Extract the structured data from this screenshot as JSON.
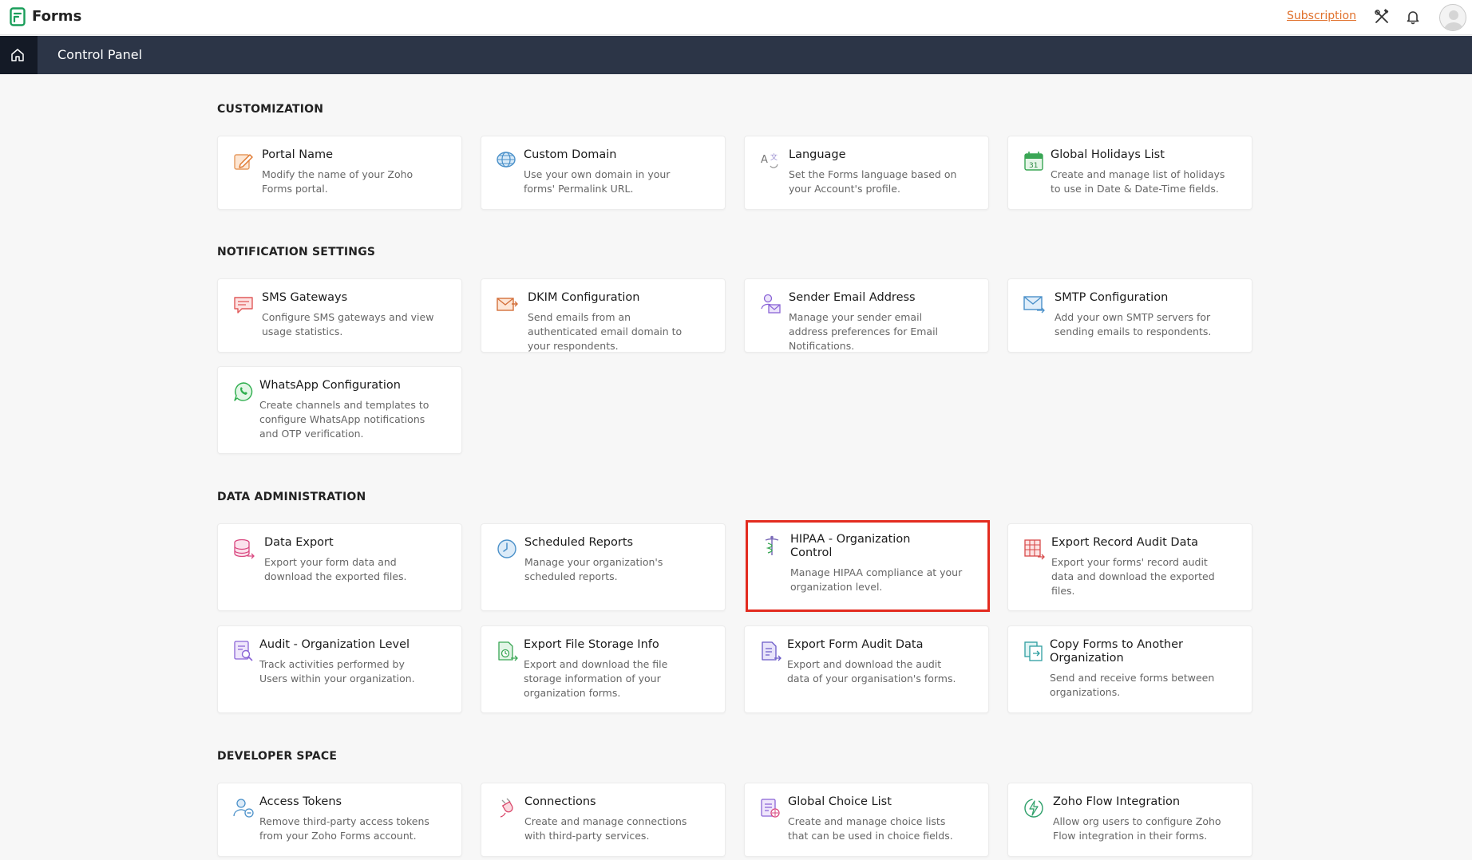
{
  "app": {
    "name": "Forms"
  },
  "topbar": {
    "subscription_label": "Subscription"
  },
  "navbar": {
    "title": "Control Panel"
  },
  "sections": {
    "customization": {
      "title": "CUSTOMIZATION",
      "cards": [
        {
          "title": "Portal Name",
          "desc": "Modify the name of your Zoho Forms portal."
        },
        {
          "title": "Custom Domain",
          "desc": "Use your own domain in your forms' Permalink URL."
        },
        {
          "title": "Language",
          "desc": "Set the Forms language based on your Account's profile."
        },
        {
          "title": "Global Holidays List",
          "desc": "Create and manage list of holidays to use in Date & Date-Time fields.",
          "icon_text": "31"
        }
      ]
    },
    "notification": {
      "title": "NOTIFICATION SETTINGS",
      "cards": [
        {
          "title": "SMS Gateways",
          "desc": "Configure SMS gateways and view usage statistics."
        },
        {
          "title": "DKIM Configuration",
          "desc": "Send emails from an authenticated email domain to your respondents."
        },
        {
          "title": "Sender Email Address",
          "desc": "Manage your sender email address preferences for Email Notifications."
        },
        {
          "title": "SMTP Configuration",
          "desc": "Add your own SMTP servers for sending emails to respondents."
        },
        {
          "title": "WhatsApp Configuration",
          "desc": "Create channels and templates to configure WhatsApp notifications and OTP verification."
        }
      ]
    },
    "data_admin": {
      "title": "DATA ADMINISTRATION",
      "cards": [
        {
          "title": "Data Export",
          "desc": "Export your form data and download the exported files."
        },
        {
          "title": "Scheduled Reports",
          "desc": "Manage your organization's scheduled reports."
        },
        {
          "title": "HIPAA - Organization Control",
          "desc": "Manage HIPAA compliance at your organization level."
        },
        {
          "title": "Export Record Audit Data",
          "desc": "Export your forms' record audit data and download the exported files."
        },
        {
          "title": "Audit - Organization Level",
          "desc": "Track activities performed by Users within your organization."
        },
        {
          "title": "Export File Storage Info",
          "desc": "Export and download the file storage information of your organization forms."
        },
        {
          "title": "Export Form Audit Data",
          "desc": "Export and download the audit data of your organisation's forms."
        },
        {
          "title": "Copy Forms to Another Organization",
          "desc": "Send and receive forms between organizations."
        }
      ]
    },
    "developer": {
      "title": "DEVELOPER SPACE",
      "cards": [
        {
          "title": "Access Tokens",
          "desc": "Remove third-party access tokens from your Zoho Forms account."
        },
        {
          "title": "Connections",
          "desc": "Create and manage connections with third-party services."
        },
        {
          "title": "Global Choice List",
          "desc": "Create and manage choice lists that can be used in choice fields."
        },
        {
          "title": "Zoho Flow Integration",
          "desc": "Allow org users to configure Zoho Flow integration in their forms."
        }
      ]
    }
  },
  "colors": {
    "accent": "#e0702b",
    "nav_bg": "#2c3547",
    "highlight": "#e32b1f"
  }
}
